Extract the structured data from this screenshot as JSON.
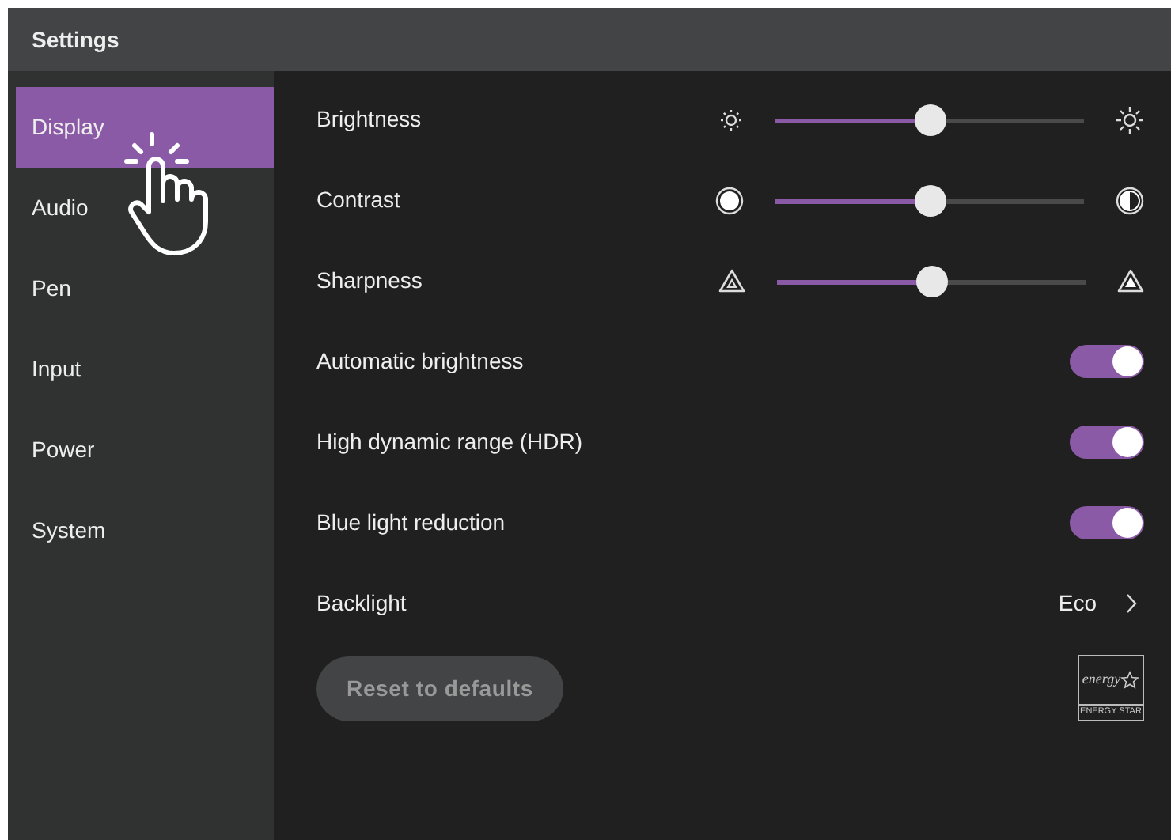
{
  "window": {
    "title": "Settings"
  },
  "sidebar": {
    "items": [
      {
        "label": "Display",
        "selected": true
      },
      {
        "label": "Audio",
        "selected": false
      },
      {
        "label": "Pen",
        "selected": false
      },
      {
        "label": "Input",
        "selected": false
      },
      {
        "label": "Power",
        "selected": false
      },
      {
        "label": "System",
        "selected": false
      }
    ]
  },
  "settings": [
    {
      "kind": "slider",
      "label": "Brightness",
      "level": 0.5
    },
    {
      "kind": "slider",
      "label": "Contrast",
      "level": 0.5
    },
    {
      "kind": "slider",
      "label": "Sharpness",
      "level": 0.5
    },
    {
      "kind": "toggle",
      "label": "Automatic brightness",
      "on": true
    },
    {
      "kind": "toggle",
      "label": "High dynamic range (HDR)",
      "on": true
    },
    {
      "kind": "toggle",
      "label": "Blue light reduction",
      "on": true
    },
    {
      "kind": "link",
      "label": "Backlight",
      "value": "Eco"
    }
  ],
  "reset_button": {
    "label": "Reset to defaults",
    "disabled": true
  },
  "energy_star": {
    "script": "energy",
    "caption": "ENERGY STAR"
  }
}
